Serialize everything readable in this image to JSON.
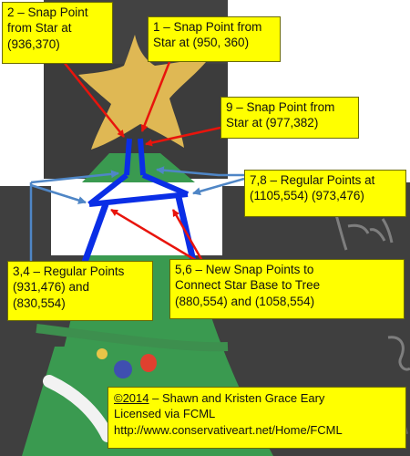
{
  "callouts": {
    "snap2": "2 – Snap Point\nfrom Star at\n(936,370)",
    "snap1": "1 – Snap Point from\nStar at (950, 360)",
    "snap9": "9 – Snap Point from\nStar at (977,382)",
    "reg78": "7,8 – Regular Points at\n(1105,554) (973,476)",
    "reg34": "3,4 – Regular Points\n(931,476) and\n(830,554)",
    "new56": "5,6 – New Snap Points to\nConnect Star Base to Tree\n(880,554) and (1058,554)"
  },
  "credit": {
    "copyright": "©2014",
    "authors": " – Shawn and Kristen Grace Eary",
    "license": "Licensed via FCML",
    "url": "http://www.conservativeart.net/Home/FCML"
  },
  "colors": {
    "callout_fill": "#ffff00",
    "red_arrow": "#e8140c",
    "blue_shape": "#0a2ee6",
    "light_blue_arrow": "#4f86c6",
    "chalkboard": "#3a3a3a",
    "tree": "#3a9a50",
    "star": "#e8bf55"
  }
}
